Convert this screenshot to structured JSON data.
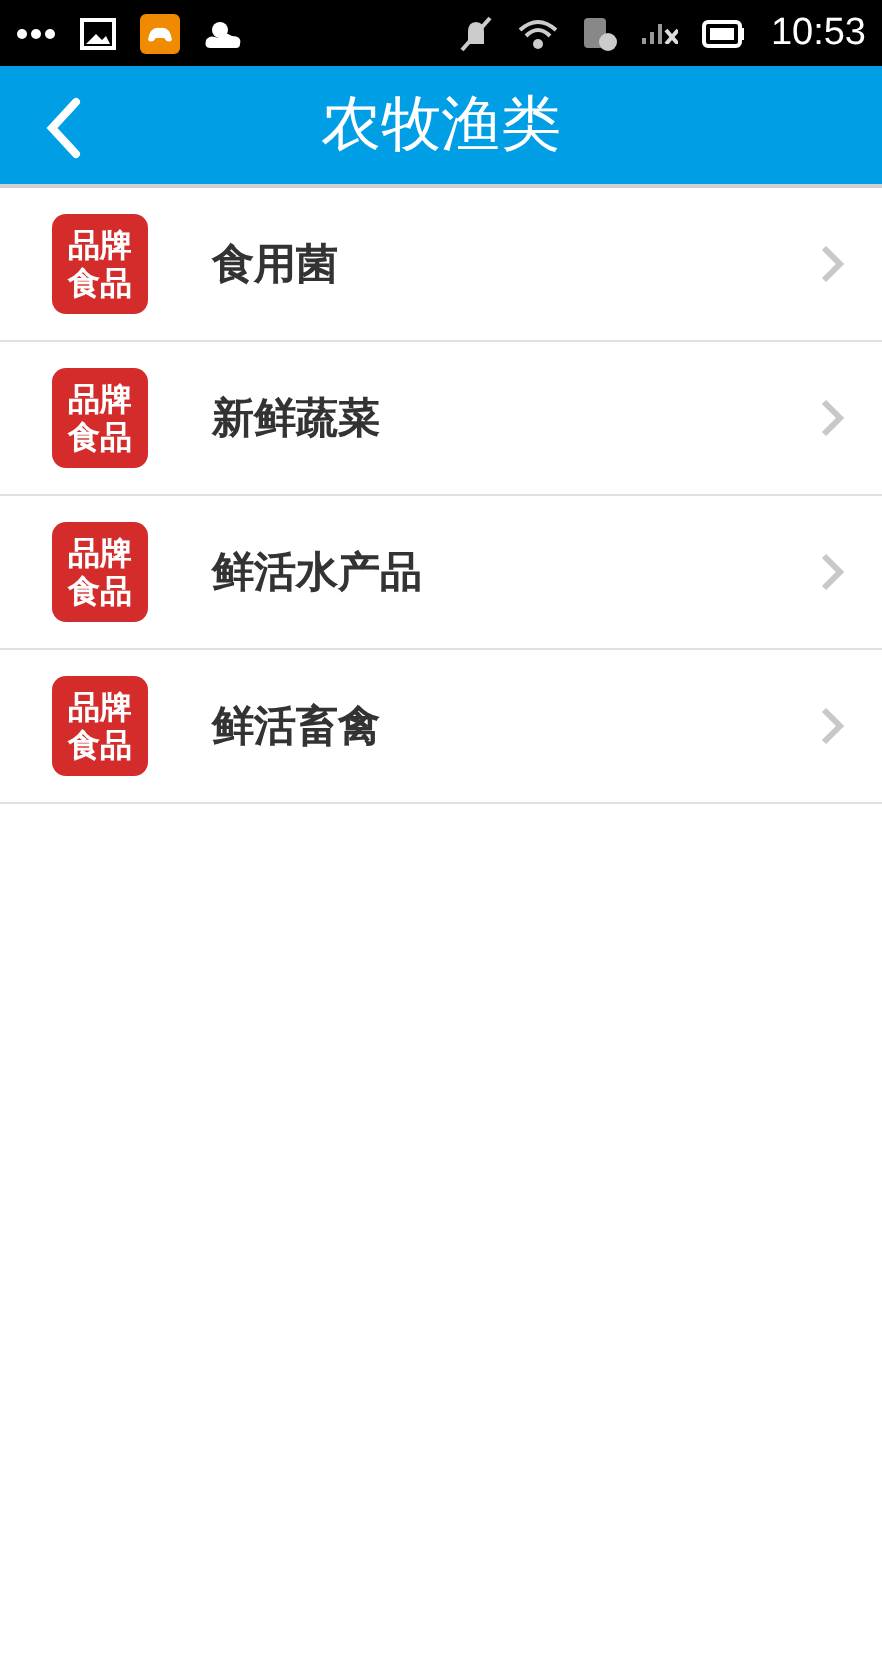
{
  "status_bar": {
    "time": "10:53"
  },
  "header": {
    "title": "农牧渔类"
  },
  "items": [
    {
      "badge_lines": [
        "品牌",
        "食品"
      ],
      "label": "食用菌"
    },
    {
      "badge_lines": [
        "品牌",
        "食品"
      ],
      "label": "新鲜蔬菜"
    },
    {
      "badge_lines": [
        "品牌",
        "食品"
      ],
      "label": "鲜活水产品"
    },
    {
      "badge_lines": [
        "品牌",
        "食品"
      ],
      "label": "鲜活畜禽"
    }
  ]
}
